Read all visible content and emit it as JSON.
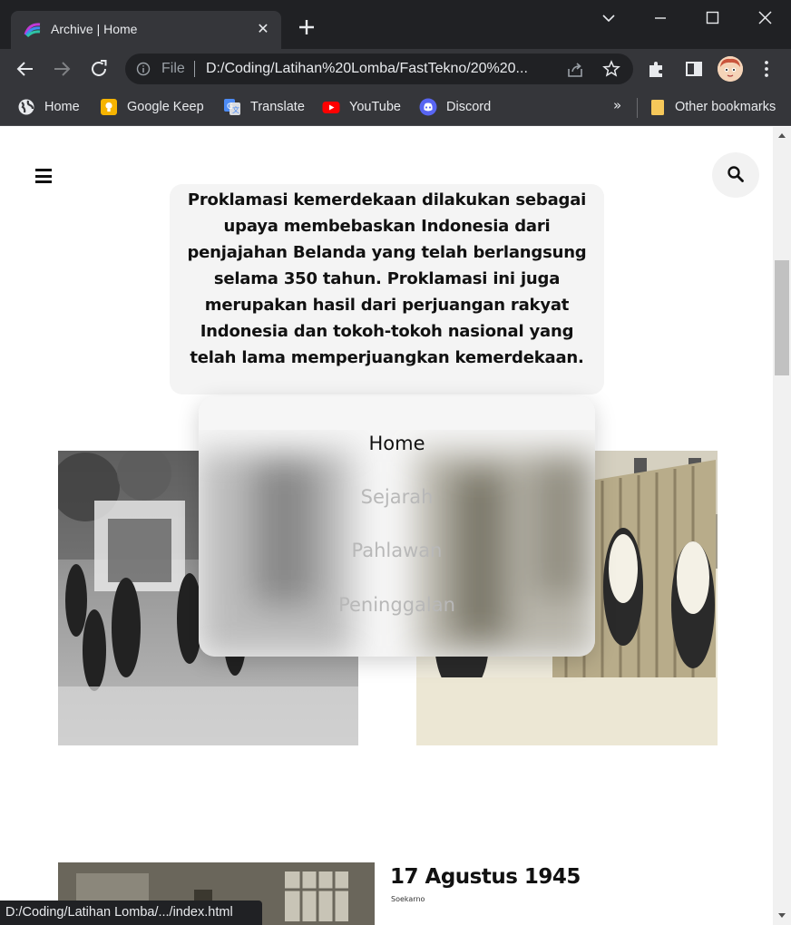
{
  "browser": {
    "tab_title": "Archive | Home",
    "omnibox_scheme": "File",
    "url": "D:/Coding/Latihan%20Lomba/FastTekno/20%20...",
    "status_url": "D:/Coding/Latihan Lomba/.../index.html",
    "bookmarks": [
      {
        "label": "Home",
        "icon": "globe-icon"
      },
      {
        "label": "Google Keep",
        "icon": "keep-icon"
      },
      {
        "label": "Translate",
        "icon": "translate-icon"
      },
      {
        "label": "YouTube",
        "icon": "youtube-icon"
      },
      {
        "label": "Discord",
        "icon": "discord-icon"
      }
    ],
    "bookmarks_overflow": "»",
    "other_bookmarks": "Other bookmarks"
  },
  "page": {
    "intro_text": "Proklamasi kemerdekaan dilakukan sebagai upaya membebaskan Indonesia dari penjajahan Belanda yang telah berlangsung selama 350 tahun. Proklamasi ini juga merupakan hasil dari perjuangan rakyat Indonesia dan tokoh-tokoh nasional yang telah lama memperjuangkan kemerdekaan.",
    "menu": [
      {
        "label": "Home",
        "active": true
      },
      {
        "label": "Sejarah",
        "active": false
      },
      {
        "label": "Pahlawan",
        "active": false
      },
      {
        "label": "Peninggalan",
        "active": false
      }
    ],
    "article": {
      "title": "17 Agustus 1945",
      "subtitle": "Soekarno"
    }
  },
  "colors": {
    "chrome_dark": "#202124",
    "chrome_mid": "#35363a",
    "card_bg": "#f4f4f4",
    "menu_active": "#111111",
    "menu_inactive": "#b8b8b8"
  }
}
